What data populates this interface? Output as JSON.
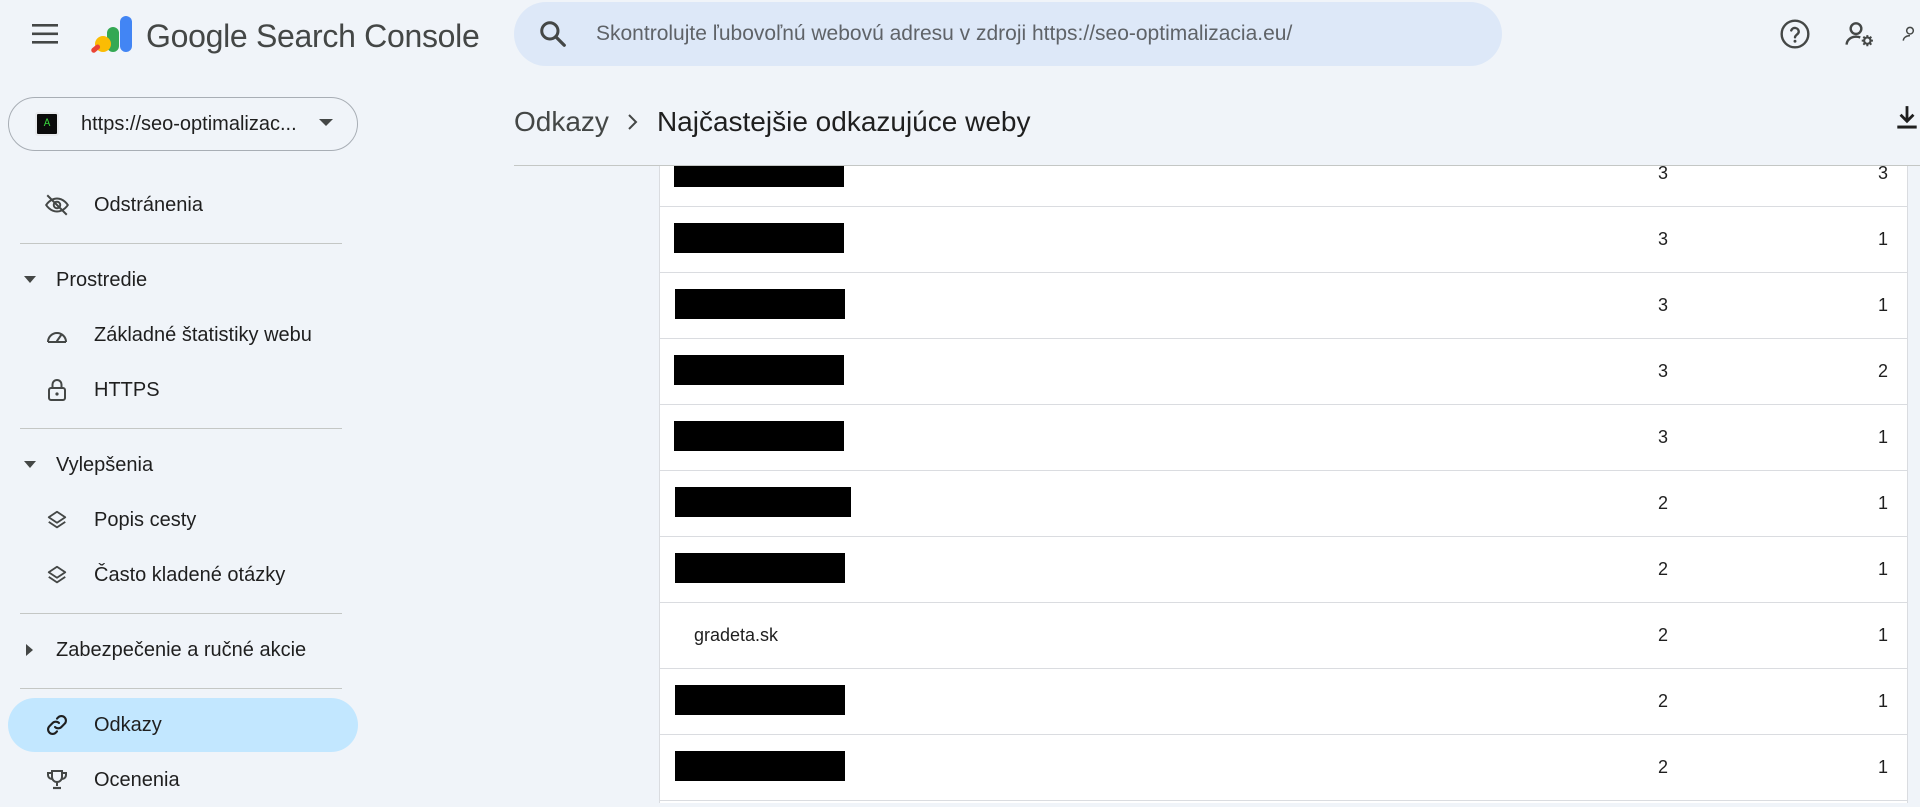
{
  "app": {
    "title_google": "Google",
    "title_product": "Search Console"
  },
  "search": {
    "placeholder": "Skontrolujte ľubovoľnú webovú adresu v zdroji https://seo-optimalizacia.eu/"
  },
  "icons": {
    "menu": "menu-icon",
    "search": "search-icon",
    "help": "help-icon",
    "admin": "manage-users-icon",
    "download": "download-icon"
  },
  "property": {
    "label": "https://seo-optimalizac...",
    "favicon_text": "A"
  },
  "sidebar": {
    "removals": "Odstránenia",
    "section_experience": "Prostredie",
    "core_web_vitals": "Základné štatistiky webu",
    "https": "HTTPS",
    "section_enhancements": "Vylepšenia",
    "breadcrumbs": "Popis cesty",
    "faq": "Často kladené otázky",
    "section_security": "Zabezpečenie a ručné akcie",
    "links": "Odkazy",
    "awards": "Ocenenia"
  },
  "breadcrumb": {
    "parent": "Odkazy",
    "current": "Najčastejšie odkazujúce weby"
  },
  "table": {
    "rows": [
      {
        "domain": "",
        "redacted": true,
        "links": "3",
        "pages": "3"
      },
      {
        "domain": "",
        "redacted": true,
        "links": "3",
        "pages": "1"
      },
      {
        "domain": "",
        "redacted": true,
        "links": "3",
        "pages": "1"
      },
      {
        "domain": "",
        "redacted": true,
        "links": "3",
        "pages": "2"
      },
      {
        "domain": "",
        "redacted": true,
        "links": "3",
        "pages": "1"
      },
      {
        "domain": "",
        "redacted": true,
        "links": "2",
        "pages": "1"
      },
      {
        "domain": "",
        "redacted": true,
        "links": "2",
        "pages": "1"
      },
      {
        "domain": "gradeta.sk",
        "redacted": false,
        "links": "2",
        "pages": "1"
      },
      {
        "domain": "",
        "redacted": true,
        "links": "2",
        "pages": "1"
      },
      {
        "domain": "",
        "redacted": true,
        "links": "2",
        "pages": "1"
      }
    ]
  },
  "colors": {
    "background": "#f0f4f9",
    "search_bg": "#dde8f8",
    "active_nav": "#c2e7ff",
    "text_primary": "#1f1f1f",
    "text_secondary": "#444746"
  }
}
